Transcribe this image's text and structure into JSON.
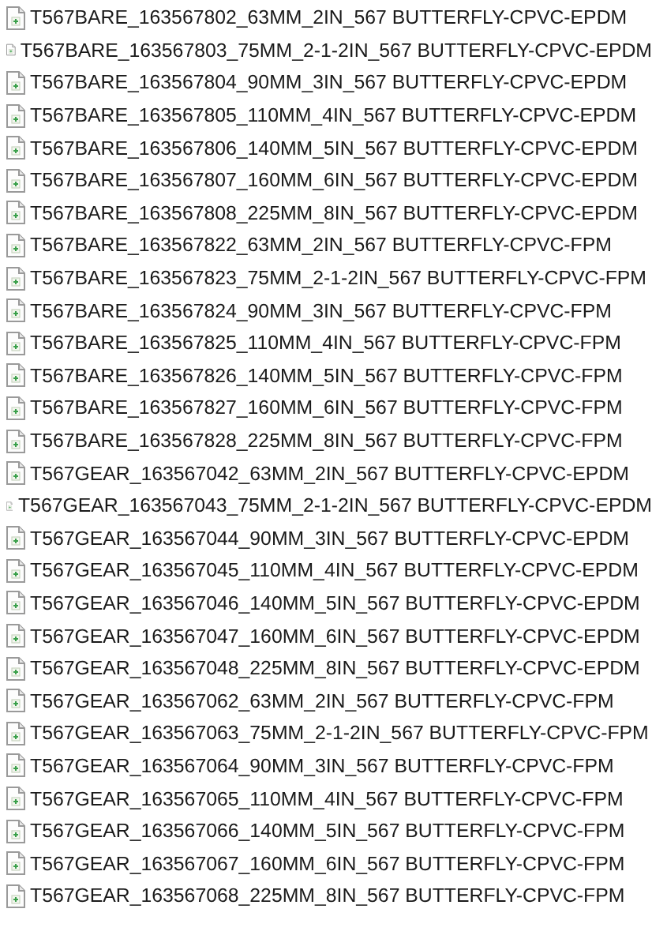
{
  "files": [
    {
      "name": "T567BARE_163567802_63MM_2IN_567 BUTTERFLY-CPVC-EPDM"
    },
    {
      "name": "T567BARE_163567803_75MM_2-1-2IN_567 BUTTERFLY-CPVC-EPDM"
    },
    {
      "name": "T567BARE_163567804_90MM_3IN_567 BUTTERFLY-CPVC-EPDM"
    },
    {
      "name": "T567BARE_163567805_110MM_4IN_567 BUTTERFLY-CPVC-EPDM"
    },
    {
      "name": "T567BARE_163567806_140MM_5IN_567 BUTTERFLY-CPVC-EPDM"
    },
    {
      "name": "T567BARE_163567807_160MM_6IN_567 BUTTERFLY-CPVC-EPDM"
    },
    {
      "name": "T567BARE_163567808_225MM_8IN_567 BUTTERFLY-CPVC-EPDM"
    },
    {
      "name": "T567BARE_163567822_63MM_2IN_567 BUTTERFLY-CPVC-FPM"
    },
    {
      "name": "T567BARE_163567823_75MM_2-1-2IN_567 BUTTERFLY-CPVC-FPM"
    },
    {
      "name": "T567BARE_163567824_90MM_3IN_567 BUTTERFLY-CPVC-FPM"
    },
    {
      "name": "T567BARE_163567825_110MM_4IN_567 BUTTERFLY-CPVC-FPM"
    },
    {
      "name": "T567BARE_163567826_140MM_5IN_567 BUTTERFLY-CPVC-FPM"
    },
    {
      "name": "T567BARE_163567827_160MM_6IN_567 BUTTERFLY-CPVC-FPM"
    },
    {
      "name": "T567BARE_163567828_225MM_8IN_567 BUTTERFLY-CPVC-FPM"
    },
    {
      "name": "T567GEAR_163567042_63MM_2IN_567 BUTTERFLY-CPVC-EPDM"
    },
    {
      "name": "T567GEAR_163567043_75MM_2-1-2IN_567 BUTTERFLY-CPVC-EPDM"
    },
    {
      "name": "T567GEAR_163567044_90MM_3IN_567 BUTTERFLY-CPVC-EPDM"
    },
    {
      "name": "T567GEAR_163567045_110MM_4IN_567 BUTTERFLY-CPVC-EPDM"
    },
    {
      "name": "T567GEAR_163567046_140MM_5IN_567 BUTTERFLY-CPVC-EPDM"
    },
    {
      "name": "T567GEAR_163567047_160MM_6IN_567 BUTTERFLY-CPVC-EPDM"
    },
    {
      "name": "T567GEAR_163567048_225MM_8IN_567 BUTTERFLY-CPVC-EPDM"
    },
    {
      "name": "T567GEAR_163567062_63MM_2IN_567 BUTTERFLY-CPVC-FPM"
    },
    {
      "name": "T567GEAR_163567063_75MM_2-1-2IN_567 BUTTERFLY-CPVC-FPM"
    },
    {
      "name": "T567GEAR_163567064_90MM_3IN_567 BUTTERFLY-CPVC-FPM"
    },
    {
      "name": "T567GEAR_163567065_110MM_4IN_567 BUTTERFLY-CPVC-FPM"
    },
    {
      "name": "T567GEAR_163567066_140MM_5IN_567 BUTTERFLY-CPVC-FPM"
    },
    {
      "name": "T567GEAR_163567067_160MM_6IN_567 BUTTERFLY-CPVC-FPM"
    },
    {
      "name": "T567GEAR_163567068_225MM_8IN_567 BUTTERFLY-CPVC-FPM"
    }
  ]
}
